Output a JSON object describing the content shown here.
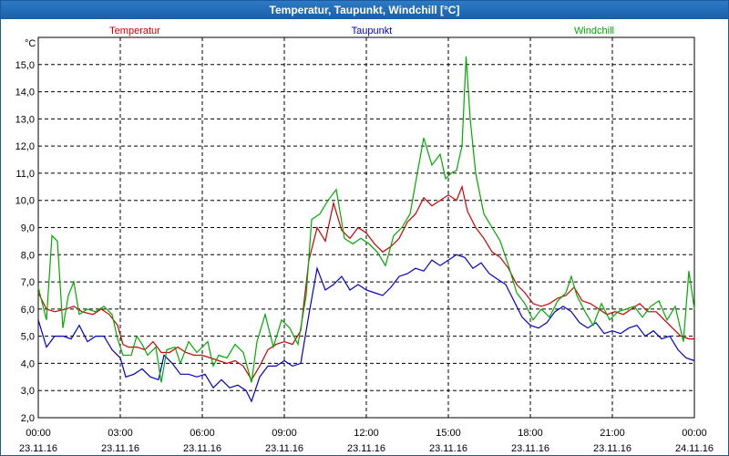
{
  "window": {
    "title": "Temperatur, Taupunkt, Windchill [°C]"
  },
  "chart_data": {
    "type": "line",
    "title": "Temperatur, Taupunkt, Windchill [°C]",
    "ylabel": "°C",
    "ylim": [
      2.0,
      16.0
    ],
    "y_ticks": [
      "2,0",
      "3,0",
      "4,0",
      "5,0",
      "6,0",
      "7,0",
      "8,0",
      "9,0",
      "10,0",
      "11,0",
      "12,0",
      "13,0",
      "14,0",
      "15,0"
    ],
    "x_ticks": [
      {
        "time": "00:00",
        "date": "23.11.16"
      },
      {
        "time": "03:00",
        "date": "23.11.16"
      },
      {
        "time": "06:00",
        "date": "23.11.16"
      },
      {
        "time": "09:00",
        "date": "23.11.16"
      },
      {
        "time": "12:00",
        "date": "23.11.16"
      },
      {
        "time": "15:00",
        "date": "23.11.16"
      },
      {
        "time": "18:00",
        "date": "23.11.16"
      },
      {
        "time": "21:00",
        "date": "23.11.16"
      },
      {
        "time": "00:00",
        "date": "24.11.16"
      }
    ],
    "x_range_hours": [
      0,
      24
    ],
    "grid": true,
    "legend_placement": "top",
    "series": [
      {
        "name": "Temperatur",
        "color": "#cc0000",
        "points": [
          [
            0,
            6.6
          ],
          [
            0.3,
            6.0
          ],
          [
            0.6,
            5.9
          ],
          [
            1,
            6.0
          ],
          [
            1.3,
            6.1
          ],
          [
            1.6,
            5.9
          ],
          [
            2,
            5.8
          ],
          [
            2.3,
            6.0
          ],
          [
            2.6,
            5.8
          ],
          [
            2.9,
            5.4
          ],
          [
            3.1,
            4.7
          ],
          [
            3.3,
            4.6
          ],
          [
            3.6,
            4.6
          ],
          [
            3.9,
            4.5
          ],
          [
            4.2,
            4.8
          ],
          [
            4.5,
            4.4
          ],
          [
            4.8,
            4.4
          ],
          [
            5.1,
            4.6
          ],
          [
            5.4,
            4.4
          ],
          [
            5.7,
            4.3
          ],
          [
            6.0,
            4.3
          ],
          [
            6.3,
            4.2
          ],
          [
            6.6,
            4.1
          ],
          [
            6.9,
            4.0
          ],
          [
            7.2,
            4.1
          ],
          [
            7.5,
            3.9
          ],
          [
            7.8,
            3.4
          ],
          [
            8.1,
            3.9
          ],
          [
            8.4,
            4.5
          ],
          [
            8.7,
            4.7
          ],
          [
            9.0,
            4.8
          ],
          [
            9.3,
            4.7
          ],
          [
            9.6,
            5.2
          ],
          [
            9.9,
            7.8
          ],
          [
            10.2,
            9.0
          ],
          [
            10.5,
            8.5
          ],
          [
            10.8,
            9.9
          ],
          [
            11.1,
            8.9
          ],
          [
            11.4,
            8.6
          ],
          [
            11.7,
            9.0
          ],
          [
            12.0,
            8.8
          ],
          [
            12.3,
            8.4
          ],
          [
            12.6,
            8.1
          ],
          [
            12.9,
            8.3
          ],
          [
            13.2,
            8.6
          ],
          [
            13.5,
            9.2
          ],
          [
            13.8,
            9.5
          ],
          [
            14.1,
            10.1
          ],
          [
            14.4,
            9.8
          ],
          [
            14.7,
            10.0
          ],
          [
            15.0,
            10.2
          ],
          [
            15.3,
            10.0
          ],
          [
            15.5,
            10.5
          ],
          [
            15.7,
            9.6
          ],
          [
            16.0,
            9.0
          ],
          [
            16.3,
            8.6
          ],
          [
            16.6,
            8.1
          ],
          [
            16.9,
            7.9
          ],
          [
            17.2,
            7.5
          ],
          [
            17.5,
            6.9
          ],
          [
            17.8,
            6.6
          ],
          [
            18.1,
            6.2
          ],
          [
            18.4,
            6.1
          ],
          [
            18.7,
            6.2
          ],
          [
            19.0,
            6.4
          ],
          [
            19.3,
            6.5
          ],
          [
            19.6,
            6.8
          ],
          [
            19.9,
            6.3
          ],
          [
            20.2,
            6.2
          ],
          [
            20.5,
            6.0
          ],
          [
            20.8,
            5.8
          ],
          [
            21.1,
            5.9
          ],
          [
            21.4,
            5.8
          ],
          [
            21.7,
            6.0
          ],
          [
            22.0,
            6.2
          ],
          [
            22.3,
            5.9
          ],
          [
            22.6,
            5.9
          ],
          [
            22.9,
            5.6
          ],
          [
            23.2,
            5.3
          ],
          [
            23.5,
            5.0
          ],
          [
            23.8,
            4.9
          ],
          [
            24.0,
            4.9
          ]
        ]
      },
      {
        "name": "Taupunkt",
        "color": "#0000cc",
        "points": [
          [
            0,
            5.6
          ],
          [
            0.3,
            4.6
          ],
          [
            0.6,
            5.0
          ],
          [
            0.9,
            5.0
          ],
          [
            1.2,
            4.9
          ],
          [
            1.5,
            5.4
          ],
          [
            1.8,
            4.8
          ],
          [
            2.1,
            5.0
          ],
          [
            2.4,
            5.0
          ],
          [
            2.7,
            4.5
          ],
          [
            3.0,
            4.2
          ],
          [
            3.2,
            3.5
          ],
          [
            3.5,
            3.6
          ],
          [
            3.8,
            3.8
          ],
          [
            4.1,
            3.5
          ],
          [
            4.4,
            3.4
          ],
          [
            4.6,
            4.3
          ],
          [
            4.9,
            4.0
          ],
          [
            5.2,
            3.6
          ],
          [
            5.5,
            3.6
          ],
          [
            5.8,
            3.5
          ],
          [
            6.1,
            3.6
          ],
          [
            6.4,
            3.1
          ],
          [
            6.7,
            3.4
          ],
          [
            7.0,
            3.1
          ],
          [
            7.3,
            3.2
          ],
          [
            7.6,
            3.0
          ],
          [
            7.8,
            2.6
          ],
          [
            8.1,
            3.5
          ],
          [
            8.4,
            3.9
          ],
          [
            8.7,
            3.9
          ],
          [
            9.0,
            4.1
          ],
          [
            9.3,
            3.9
          ],
          [
            9.6,
            4.0
          ],
          [
            9.9,
            5.8
          ],
          [
            10.2,
            7.5
          ],
          [
            10.5,
            6.7
          ],
          [
            10.8,
            6.9
          ],
          [
            11.1,
            7.2
          ],
          [
            11.4,
            6.7
          ],
          [
            11.7,
            6.9
          ],
          [
            12.0,
            6.7
          ],
          [
            12.3,
            6.6
          ],
          [
            12.6,
            6.5
          ],
          [
            12.9,
            6.8
          ],
          [
            13.2,
            7.2
          ],
          [
            13.5,
            7.3
          ],
          [
            13.8,
            7.5
          ],
          [
            14.1,
            7.4
          ],
          [
            14.4,
            7.8
          ],
          [
            14.7,
            7.6
          ],
          [
            15.0,
            7.8
          ],
          [
            15.3,
            8.0
          ],
          [
            15.6,
            7.9
          ],
          [
            15.9,
            7.5
          ],
          [
            16.2,
            7.7
          ],
          [
            16.5,
            7.3
          ],
          [
            16.8,
            7.1
          ],
          [
            17.1,
            6.9
          ],
          [
            17.4,
            6.3
          ],
          [
            17.7,
            5.7
          ],
          [
            18.0,
            5.4
          ],
          [
            18.3,
            5.3
          ],
          [
            18.6,
            5.5
          ],
          [
            18.9,
            5.9
          ],
          [
            19.2,
            6.1
          ],
          [
            19.5,
            5.9
          ],
          [
            19.8,
            5.5
          ],
          [
            20.1,
            5.3
          ],
          [
            20.4,
            5.5
          ],
          [
            20.7,
            5.1
          ],
          [
            21.0,
            5.2
          ],
          [
            21.3,
            5.1
          ],
          [
            21.6,
            5.3
          ],
          [
            21.9,
            5.4
          ],
          [
            22.2,
            5.0
          ],
          [
            22.5,
            5.2
          ],
          [
            22.8,
            4.9
          ],
          [
            23.1,
            5.0
          ],
          [
            23.4,
            4.5
          ],
          [
            23.7,
            4.2
          ],
          [
            24.0,
            4.1
          ]
        ]
      },
      {
        "name": "Windchill",
        "color": "#00aa00",
        "points": [
          [
            0,
            6.8
          ],
          [
            0.3,
            5.6
          ],
          [
            0.5,
            8.7
          ],
          [
            0.7,
            8.5
          ],
          [
            0.9,
            5.3
          ],
          [
            1.1,
            6.5
          ],
          [
            1.3,
            7.0
          ],
          [
            1.5,
            5.8
          ],
          [
            1.8,
            6.0
          ],
          [
            2.1,
            5.9
          ],
          [
            2.4,
            6.1
          ],
          [
            2.7,
            5.8
          ],
          [
            2.9,
            4.9
          ],
          [
            3.1,
            4.3
          ],
          [
            3.4,
            4.3
          ],
          [
            3.6,
            5.0
          ],
          [
            3.8,
            4.7
          ],
          [
            4.0,
            4.3
          ],
          [
            4.3,
            4.6
          ],
          [
            4.5,
            3.3
          ],
          [
            4.7,
            4.5
          ],
          [
            5.0,
            4.6
          ],
          [
            5.2,
            4.0
          ],
          [
            5.5,
            4.8
          ],
          [
            5.8,
            4.4
          ],
          [
            6.0,
            4.6
          ],
          [
            6.2,
            4.8
          ],
          [
            6.4,
            3.9
          ],
          [
            6.6,
            4.3
          ],
          [
            6.9,
            4.2
          ],
          [
            7.2,
            4.7
          ],
          [
            7.5,
            4.4
          ],
          [
            7.8,
            3.3
          ],
          [
            8.0,
            4.8
          ],
          [
            8.3,
            5.8
          ],
          [
            8.6,
            4.6
          ],
          [
            8.9,
            5.6
          ],
          [
            9.2,
            5.3
          ],
          [
            9.5,
            4.7
          ],
          [
            9.8,
            6.5
          ],
          [
            10.0,
            9.3
          ],
          [
            10.3,
            9.5
          ],
          [
            10.6,
            10.0
          ],
          [
            10.9,
            10.4
          ],
          [
            11.2,
            8.6
          ],
          [
            11.5,
            8.4
          ],
          [
            11.8,
            8.6
          ],
          [
            12.1,
            8.4
          ],
          [
            12.4,
            8.1
          ],
          [
            12.7,
            7.6
          ],
          [
            13.0,
            8.7
          ],
          [
            13.3,
            9.0
          ],
          [
            13.6,
            9.5
          ],
          [
            13.9,
            11.2
          ],
          [
            14.1,
            12.3
          ],
          [
            14.4,
            11.3
          ],
          [
            14.7,
            11.7
          ],
          [
            14.9,
            10.8
          ],
          [
            15.1,
            11.0
          ],
          [
            15.3,
            11.1
          ],
          [
            15.5,
            12.0
          ],
          [
            15.65,
            15.3
          ],
          [
            15.8,
            13.0
          ],
          [
            16.0,
            11.0
          ],
          [
            16.3,
            9.5
          ],
          [
            16.6,
            9.0
          ],
          [
            16.9,
            8.5
          ],
          [
            17.2,
            7.6
          ],
          [
            17.5,
            6.6
          ],
          [
            17.8,
            6.2
          ],
          [
            18.1,
            5.6
          ],
          [
            18.4,
            6.0
          ],
          [
            18.7,
            5.7
          ],
          [
            19.0,
            6.3
          ],
          [
            19.3,
            6.6
          ],
          [
            19.5,
            7.2
          ],
          [
            19.7,
            6.5
          ],
          [
            20.0,
            5.9
          ],
          [
            20.3,
            5.4
          ],
          [
            20.6,
            6.2
          ],
          [
            20.9,
            5.6
          ],
          [
            21.2,
            5.9
          ],
          [
            21.5,
            6.0
          ],
          [
            21.8,
            6.1
          ],
          [
            22.1,
            5.7
          ],
          [
            22.4,
            6.1
          ],
          [
            22.7,
            6.3
          ],
          [
            23.0,
            5.6
          ],
          [
            23.3,
            6.1
          ],
          [
            23.6,
            4.8
          ],
          [
            23.8,
            7.4
          ],
          [
            24.0,
            6.0
          ]
        ]
      }
    ]
  }
}
